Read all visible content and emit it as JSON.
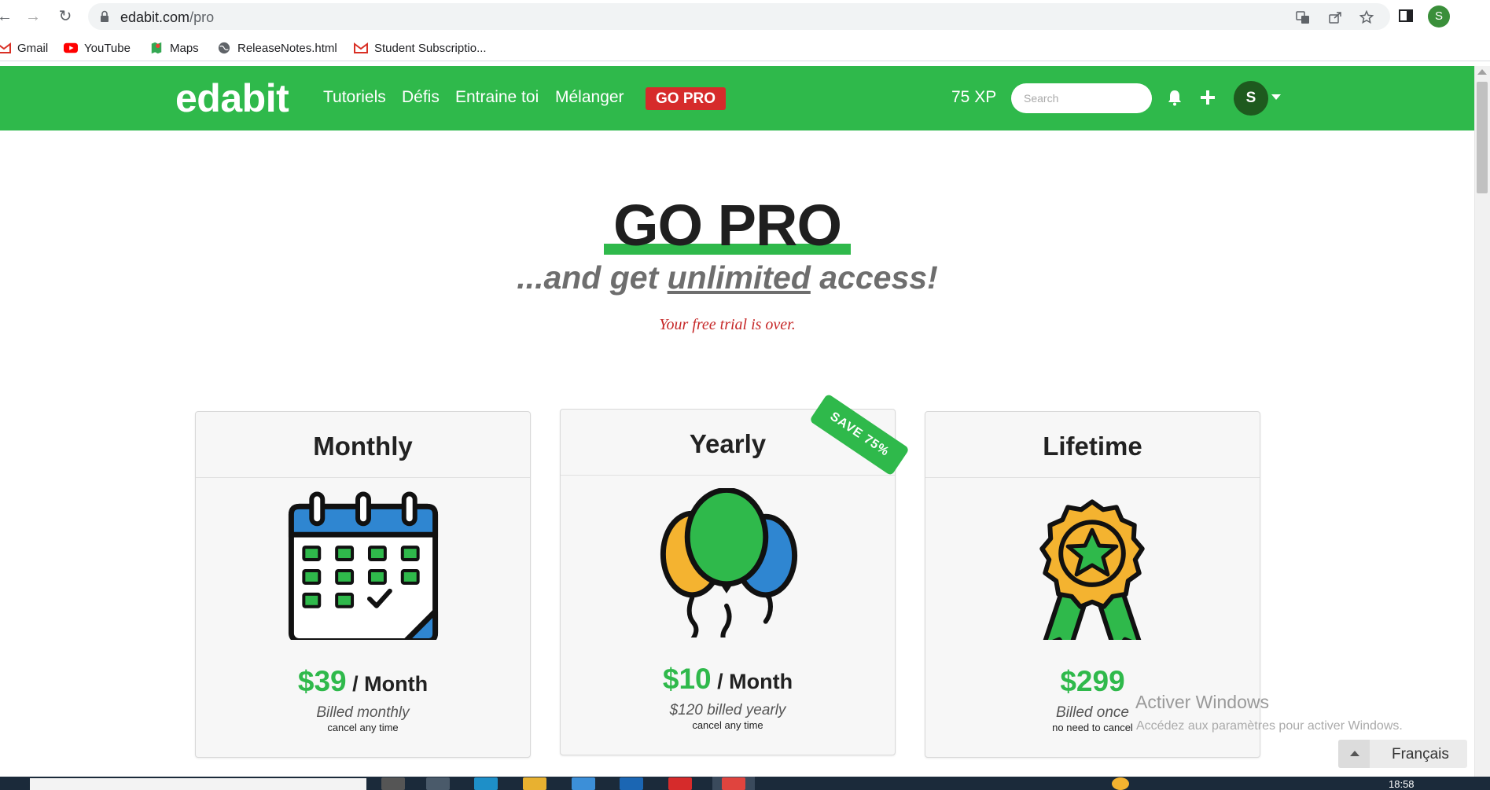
{
  "browser": {
    "url_host": "edabit.com",
    "url_path": "/pro",
    "profile_initial": "S",
    "bookmarks": [
      {
        "label": "Gmail",
        "icon": "gmail-icon"
      },
      {
        "label": "YouTube",
        "icon": "youtube-icon"
      },
      {
        "label": "Maps",
        "icon": "maps-icon"
      },
      {
        "label": "ReleaseNotes.html",
        "icon": "globe-icon"
      },
      {
        "label": "Student Subscriptio...",
        "icon": "gmail-icon"
      }
    ]
  },
  "header": {
    "logo": "edabit",
    "nav": [
      "Tutoriels",
      "Défis",
      "Entraine toi",
      "Mélanger"
    ],
    "go_pro": "GO PRO",
    "xp": "75 XP",
    "search_placeholder": "Search",
    "avatar_initial": "S"
  },
  "hero": {
    "title": "GO PRO",
    "sub_pre": "...and get ",
    "sub_ul": "unlimited",
    "sub_post": " access!",
    "trial": "Your free trial is over."
  },
  "plans": [
    {
      "name": "Monthly",
      "price": "$39",
      "period": " / Month",
      "billed": "Billed monthly",
      "cancel": "cancel any time",
      "icon": "calendar-icon"
    },
    {
      "name": "Yearly",
      "price": "$10",
      "period": " / Month",
      "billed": "$120 billed yearly",
      "cancel": "cancel any time",
      "icon": "balloons-icon",
      "badge": "SAVE 75%"
    },
    {
      "name": "Lifetime",
      "price": "$299",
      "period": "",
      "billed": "Billed once",
      "cancel": "no need to cancel",
      "icon": "award-icon"
    }
  ],
  "overlay": {
    "win_title": "Activer Windows",
    "win_sub": "Accédez aux paramètres pour activer Windows.",
    "language": "Français"
  },
  "taskbar": {
    "time": "18:58"
  },
  "colors": {
    "brand_green": "#2fb94b",
    "go_pro_red": "#d62b2b",
    "trial_red": "#c62828"
  }
}
